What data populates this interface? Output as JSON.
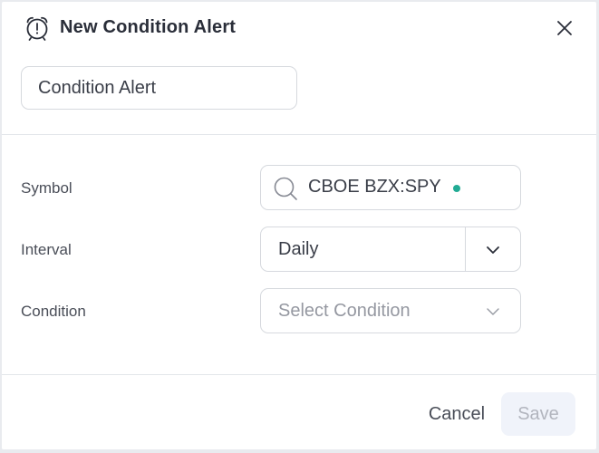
{
  "dialog": {
    "title": "New Condition Alert",
    "title_icon": "alarm-clock-icon",
    "close_icon": "close-icon"
  },
  "alert_name": {
    "value": "Condition Alert"
  },
  "rows": {
    "symbol": {
      "label": "Symbol",
      "value": "CBOE BZX:SPY",
      "icon": "search-icon",
      "status_color": "#22ab94"
    },
    "interval": {
      "label": "Interval",
      "value": "Daily",
      "icon": "chevron-down-icon"
    },
    "condition": {
      "label": "Condition",
      "placeholder": "Select Condition",
      "icon": "chevron-down-icon"
    }
  },
  "footer": {
    "cancel_label": "Cancel",
    "save_label": "Save"
  },
  "colors": {
    "accent_status": "#22ab94",
    "text": "#2a2e39",
    "border": "#d6d9de",
    "save_disabled_bg": "#f0f3fa"
  }
}
